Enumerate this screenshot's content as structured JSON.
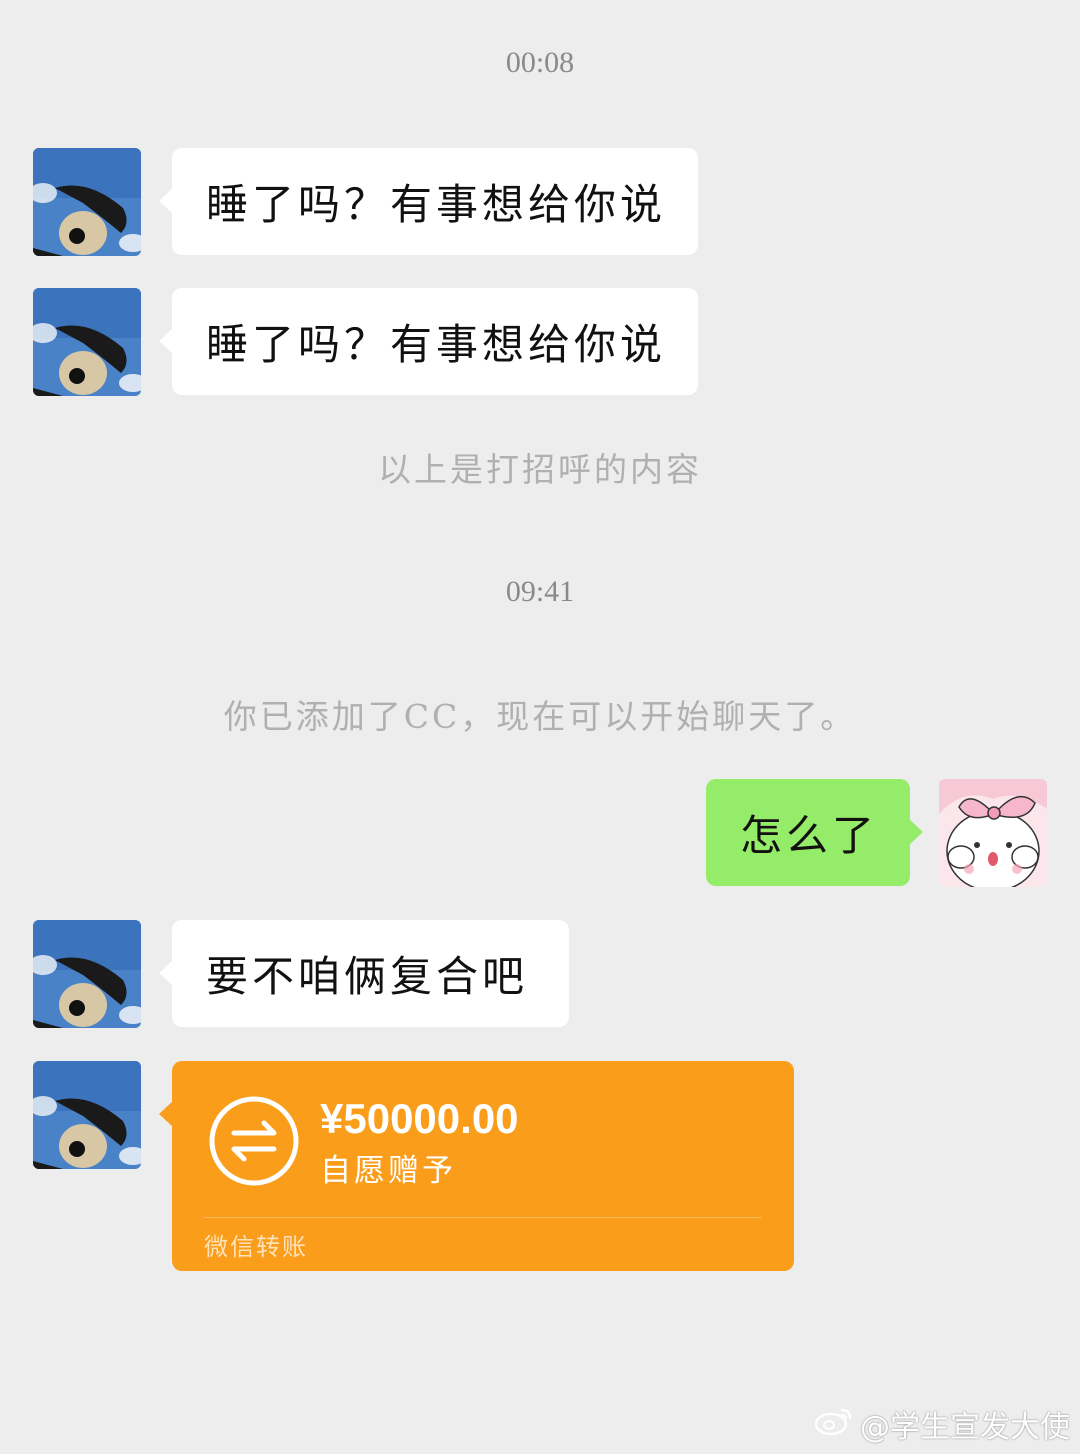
{
  "messages": {
    "time_1": "00:08",
    "msg_1": "睡了吗？有事想给你说",
    "msg_2": "睡了吗？有事想给你说",
    "system_1": "以上是打招呼的内容",
    "time_2": "09:41",
    "system_2": "你已添加了CC，现在可以开始聊天了。",
    "msg_3_outgoing": "怎么了",
    "msg_4": "要不咱俩复合吧"
  },
  "transfer": {
    "amount": "¥50000.00",
    "note": "自愿赠予",
    "label": "微信转账"
  },
  "watermark": {
    "text": "@学生宣发大使"
  },
  "colors": {
    "background": "#ededed",
    "incoming_bubble": "#ffffff",
    "outgoing_bubble": "#95ec69",
    "transfer_card": "#fa9d1a"
  },
  "icons": {
    "contact_avatar": "dog-on-sky-avatar",
    "my_avatar": "pink-bow-bunny-avatar",
    "transfer": "transfer-arrows-icon",
    "watermark": "weibo-logo-icon"
  }
}
